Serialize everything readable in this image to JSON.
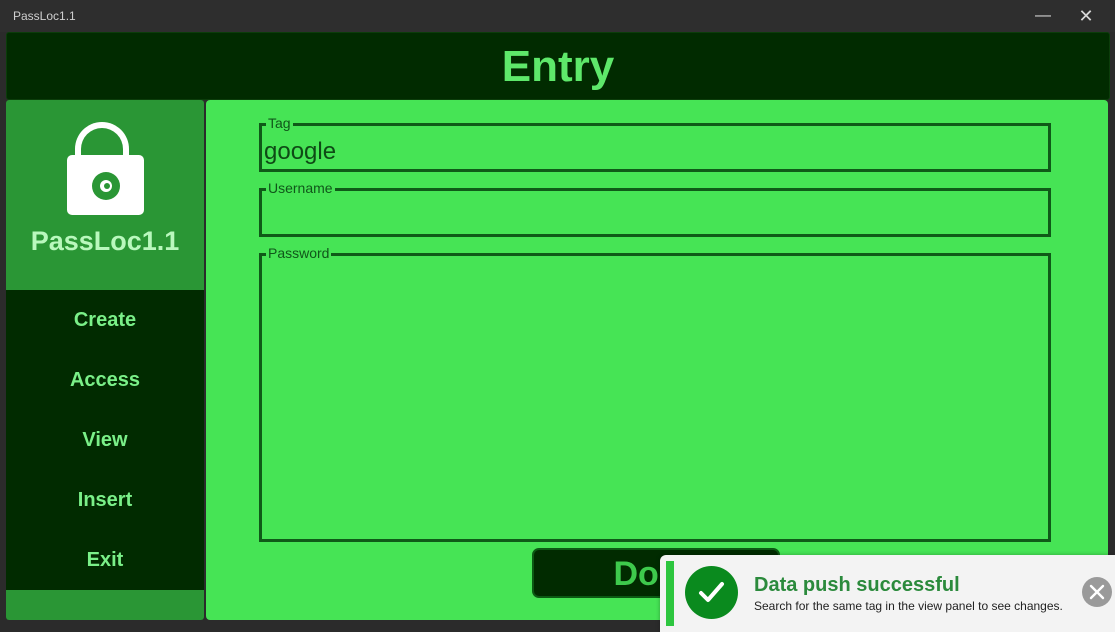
{
  "window": {
    "title": "PassLoc1.1",
    "minimize_glyph": "—",
    "close_glyph": "✕"
  },
  "header": {
    "title": "Entry"
  },
  "sidebar": {
    "app_name": "PassLoc1.1",
    "logo_icon": "lock-eye-icon",
    "items": [
      {
        "label": "Create"
      },
      {
        "label": "Access"
      },
      {
        "label": "View"
      },
      {
        "label": "Insert"
      },
      {
        "label": "Exit"
      }
    ]
  },
  "form": {
    "tag": {
      "label": "Tag",
      "value": "google"
    },
    "username": {
      "label": "Username",
      "value": ""
    },
    "password": {
      "label": "Password",
      "value": ""
    },
    "done_label": "Done"
  },
  "toast": {
    "title": "Data push successful",
    "message": "Search for the same tag in the view panel to see changes.",
    "icon": "check-circle-icon"
  },
  "colors": {
    "header_bg": "#012b00",
    "accent_green": "#46e455",
    "logo_green": "#2a9635",
    "nav_text": "#7af088"
  }
}
